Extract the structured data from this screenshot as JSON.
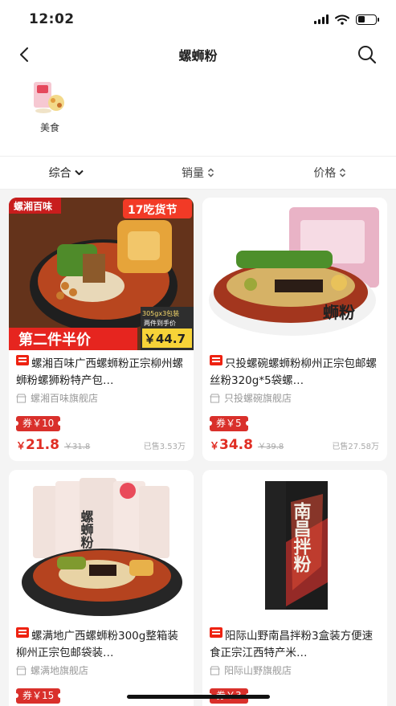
{
  "status_bar": {
    "time": "12:02"
  },
  "nav": {
    "title": "螺蛳粉"
  },
  "categories": [
    {
      "label": "美食"
    }
  ],
  "sort": {
    "comprehensive": "综合",
    "sales": "销量",
    "price": "价格"
  },
  "products": [
    {
      "title": "螺湘百味广西螺蛳粉正宗柳州螺蛳粉螺狮粉特产包…",
      "shop": "螺湘百味旗舰店",
      "coupon": "券￥10",
      "price_symbol": "￥",
      "price": "21.8",
      "original_price": "￥31.8",
      "sold": "已售3.53万",
      "image": {
        "brand": "螺湘百味",
        "badge": "17吃货节",
        "promo": "第二件半价",
        "pack": "305gx3包装",
        "deal_label": "两件到手价",
        "deal_price": "￥44.7"
      }
    },
    {
      "title": "只投螺碗螺蛳粉柳州正宗包邮螺丝粉320g*5袋螺…",
      "shop": "只投螺碗旗舰店",
      "coupon": "券￥5",
      "price_symbol": "￥",
      "price": "34.8",
      "original_price": "￥39.8",
      "sold": "已售27.58万",
      "image": {
        "text": "蛳粉"
      }
    },
    {
      "title": "螺满地广西螺蛳粉300g整箱装 柳州正宗包邮袋装…",
      "shop": "螺满地旗舰店",
      "coupon": "券￥15",
      "price_symbol": "",
      "price": "",
      "original_price": "",
      "sold": "",
      "image": {
        "text": "螺蛳粉"
      }
    },
    {
      "title": "阳际山野南昌拌粉3盒装方便速食正宗江西特产米…",
      "shop": "阳际山野旗舰店",
      "coupon": "券￥3",
      "price_symbol": "",
      "price": "",
      "original_price": "",
      "sold": "",
      "image": {
        "text": "南昌拌粉"
      }
    }
  ],
  "colors": {
    "accent": "#e02e24",
    "coupon": "#d9302b"
  }
}
